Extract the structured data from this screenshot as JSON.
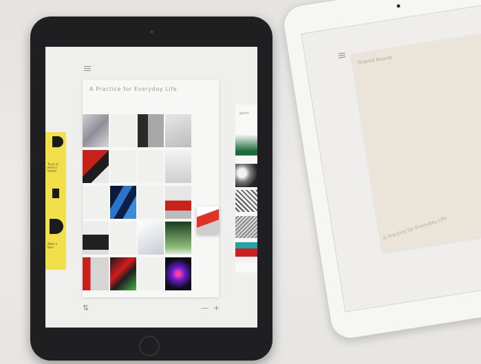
{
  "photo": {
    "description_colors": {
      "table": "#ebeae8",
      "ipad_dark": "#1f1f21",
      "ipad_white": "#f6f6f5",
      "accent_yellow": "#f2e04a"
    }
  },
  "left_device": {
    "board_title": "A Practice for Everyday Life",
    "side_left_labels": [
      "Touch &",
      "Hold to",
      "Delete",
      "Make a",
      "New"
    ],
    "side_right_title": "geom",
    "icons": [
      "menu-icon",
      "sort-icon",
      "minus-icon",
      "plus-icon"
    ],
    "controls": {
      "minus": "—",
      "plus": "+",
      "sort": "⇅"
    }
  },
  "right_device": {
    "board_title": "Shared Boards",
    "paper_subtitle": "A Practice for Everyday Life",
    "icons": [
      "menu-icon"
    ]
  }
}
